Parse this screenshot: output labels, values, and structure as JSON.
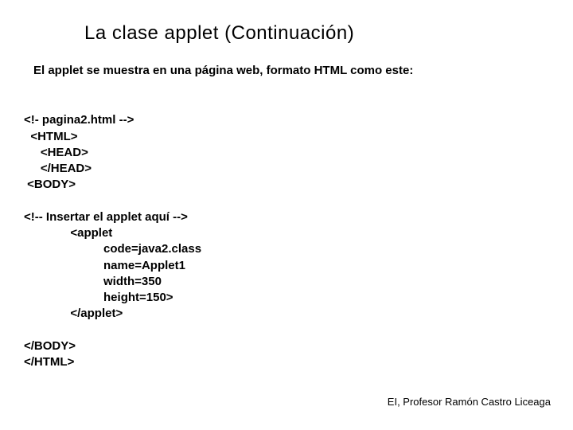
{
  "title": "La clase applet (Continuación)",
  "intro": "El applet se muestra en una página web, formato HTML como este:",
  "code": {
    "l1": "<!- pagina2.html -->",
    "l2": "  <HTML>",
    "l3": "     <HEAD>",
    "l4": "     </HEAD>",
    "l5": " <BODY>",
    "l6": "",
    "l7": "<!-- Insertar el applet aquí -->",
    "l8": "              <applet",
    "l9": "                        code=java2.class",
    "l10": "                        name=Applet1",
    "l11": "                        width=350",
    "l12": "                        height=150>",
    "l13": "              </applet>",
    "l14": "",
    "l15": "</BODY>",
    "l16": "</HTML>"
  },
  "footer": "EI, Profesor Ramón Castro Liceaga"
}
